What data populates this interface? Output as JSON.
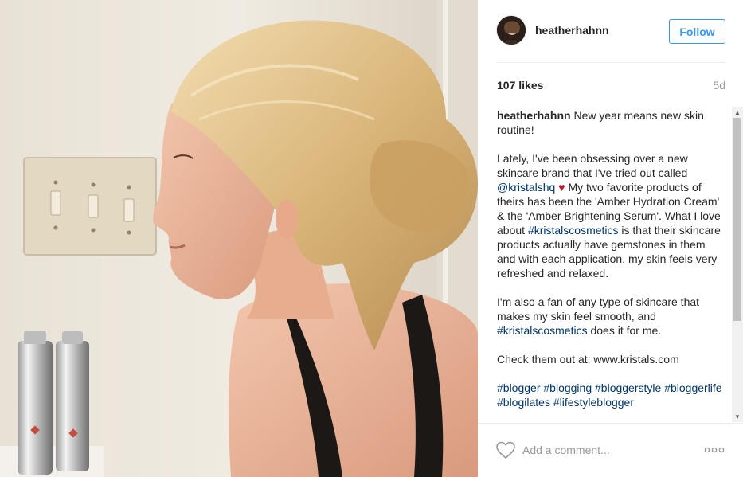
{
  "post": {
    "username": "heatherhahnn",
    "follow_label": "Follow",
    "likes": "107 likes",
    "time_ago": "5d",
    "caption": {
      "username": "heatherhahnn",
      "intro": "New year means new skin routine!",
      "p2_before": "Lately, I've been obsessing over a new skincare brand that I've tried out called",
      "p2_mention": "@kristalshq",
      "p2_heart": "♥",
      "p2_middle": "My two favorite products of theirs has been the 'Amber Hydration Cream' & the 'Amber Brightening Serum'. What I love about",
      "p2_hashtag": "#kristalscosmetics",
      "p2_after": "is that their skincare products actually have gemstones in them and with each application, my skin feels very refreshed and relaxed.",
      "p3_before": "I'm also a fan of any type of skincare that makes my skin feel smooth, and",
      "p3_hashtag": "#kristalscosmetics",
      "p3_after": "does it for me.",
      "p4": "Check them out at: www.kristals.com",
      "tags": [
        "#blogger",
        "#blogging",
        "#bloggerstyle",
        "#bloggerlife",
        "#blogilates",
        "#lifestyleblogger"
      ]
    },
    "comment_placeholder": "Add a comment...",
    "icons": {
      "like": "heart-outline-icon",
      "more": "more-options-icon",
      "scroll_up": "▲",
      "scroll_down": "▼"
    },
    "colors": {
      "accent": "#3897f0",
      "link": "#003569",
      "heart": "#c0192a",
      "muted": "#999999"
    }
  }
}
